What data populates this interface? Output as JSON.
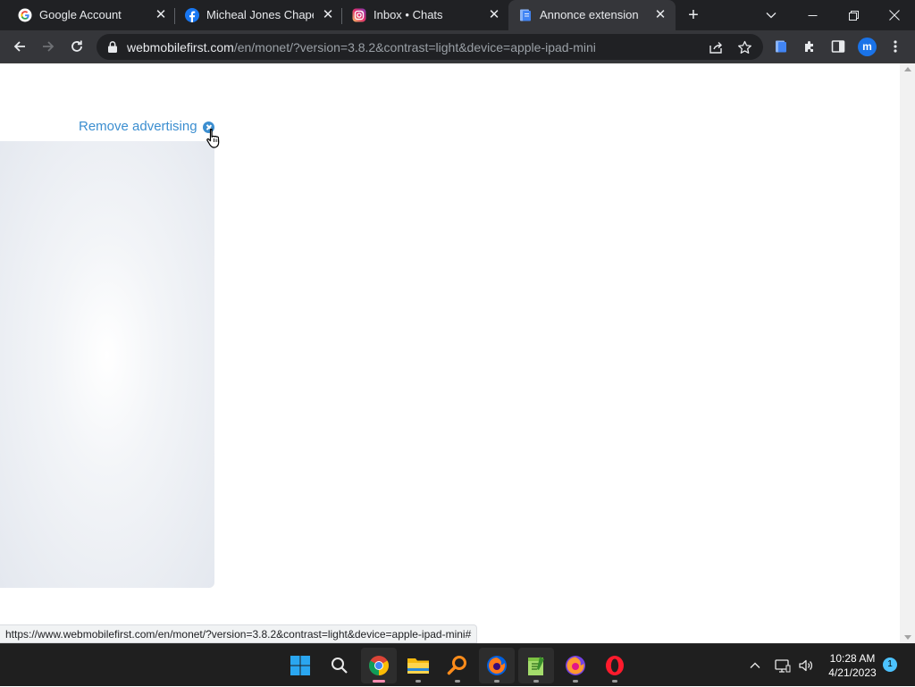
{
  "browser": {
    "tabs": [
      {
        "title": "Google Account",
        "favicon": "google-icon",
        "active": false
      },
      {
        "title": "Micheal Jones Chapel |",
        "favicon": "facebook-icon",
        "active": false
      },
      {
        "title": "Inbox • Chats",
        "favicon": "instagram-icon",
        "active": false
      },
      {
        "title": "Annonce extension",
        "favicon": "document-icon",
        "active": true
      }
    ],
    "new_tab": "+",
    "url_host": "webmobilefirst.com",
    "url_path": "/en/monet/?version=3.8.2&contrast=light&device=apple-ipad-mini",
    "profile_initial": "m",
    "colors": {
      "tab_strip": "#202124",
      "toolbar": "#35363a",
      "omnibox": "#202124",
      "accent": "#1a73e8"
    }
  },
  "page": {
    "remove_ad_label": "Remove advertising",
    "link_color": "#3b8ed0",
    "status_url": "https://www.webmobilefirst.com/en/monet/?version=3.8.2&contrast=light&device=apple-ipad-mini#"
  },
  "taskbar": {
    "apps": [
      "windows-start-icon",
      "search-icon",
      "chrome-icon",
      "file-explorer-icon",
      "search-app-icon",
      "firefox-dev-icon",
      "notepad-plus-icon",
      "firefox-icon",
      "opera-icon"
    ],
    "time": "10:28 AM",
    "date": "4/21/2023",
    "notification_count": "1"
  }
}
